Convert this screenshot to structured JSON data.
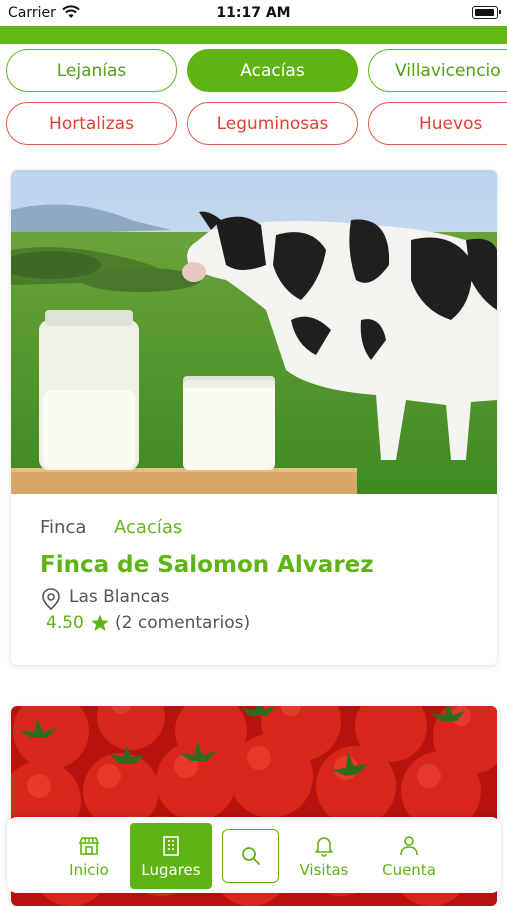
{
  "status": {
    "carrier": "Carrier",
    "time": "11:17 AM"
  },
  "locations": [
    {
      "label": "Lejanías",
      "active": false
    },
    {
      "label": "Acacías",
      "active": true
    },
    {
      "label": "Villavicencio",
      "active": false
    }
  ],
  "categories": [
    {
      "label": "Hortalizas"
    },
    {
      "label": "Leguminosas"
    },
    {
      "label": "Huevos"
    }
  ],
  "cards": [
    {
      "type": "Finca",
      "location": "Acacías",
      "title": "Finca de Salomon Alvarez",
      "place": "Las Blancas",
      "rating": "4.50",
      "reviews": "(2 comentarios)"
    }
  ],
  "tabs": [
    {
      "label": "Inicio",
      "icon": "store-icon",
      "active": false
    },
    {
      "label": "Lugares",
      "icon": "building-icon",
      "active": true
    },
    {
      "label": "",
      "icon": "search-icon",
      "active": false
    },
    {
      "label": "Visitas",
      "icon": "bell-icon",
      "active": false
    },
    {
      "label": "Cuenta",
      "icon": "user-icon",
      "active": false
    }
  ],
  "colors": {
    "brand_green": "#62b815",
    "category_red": "#e0412f"
  }
}
